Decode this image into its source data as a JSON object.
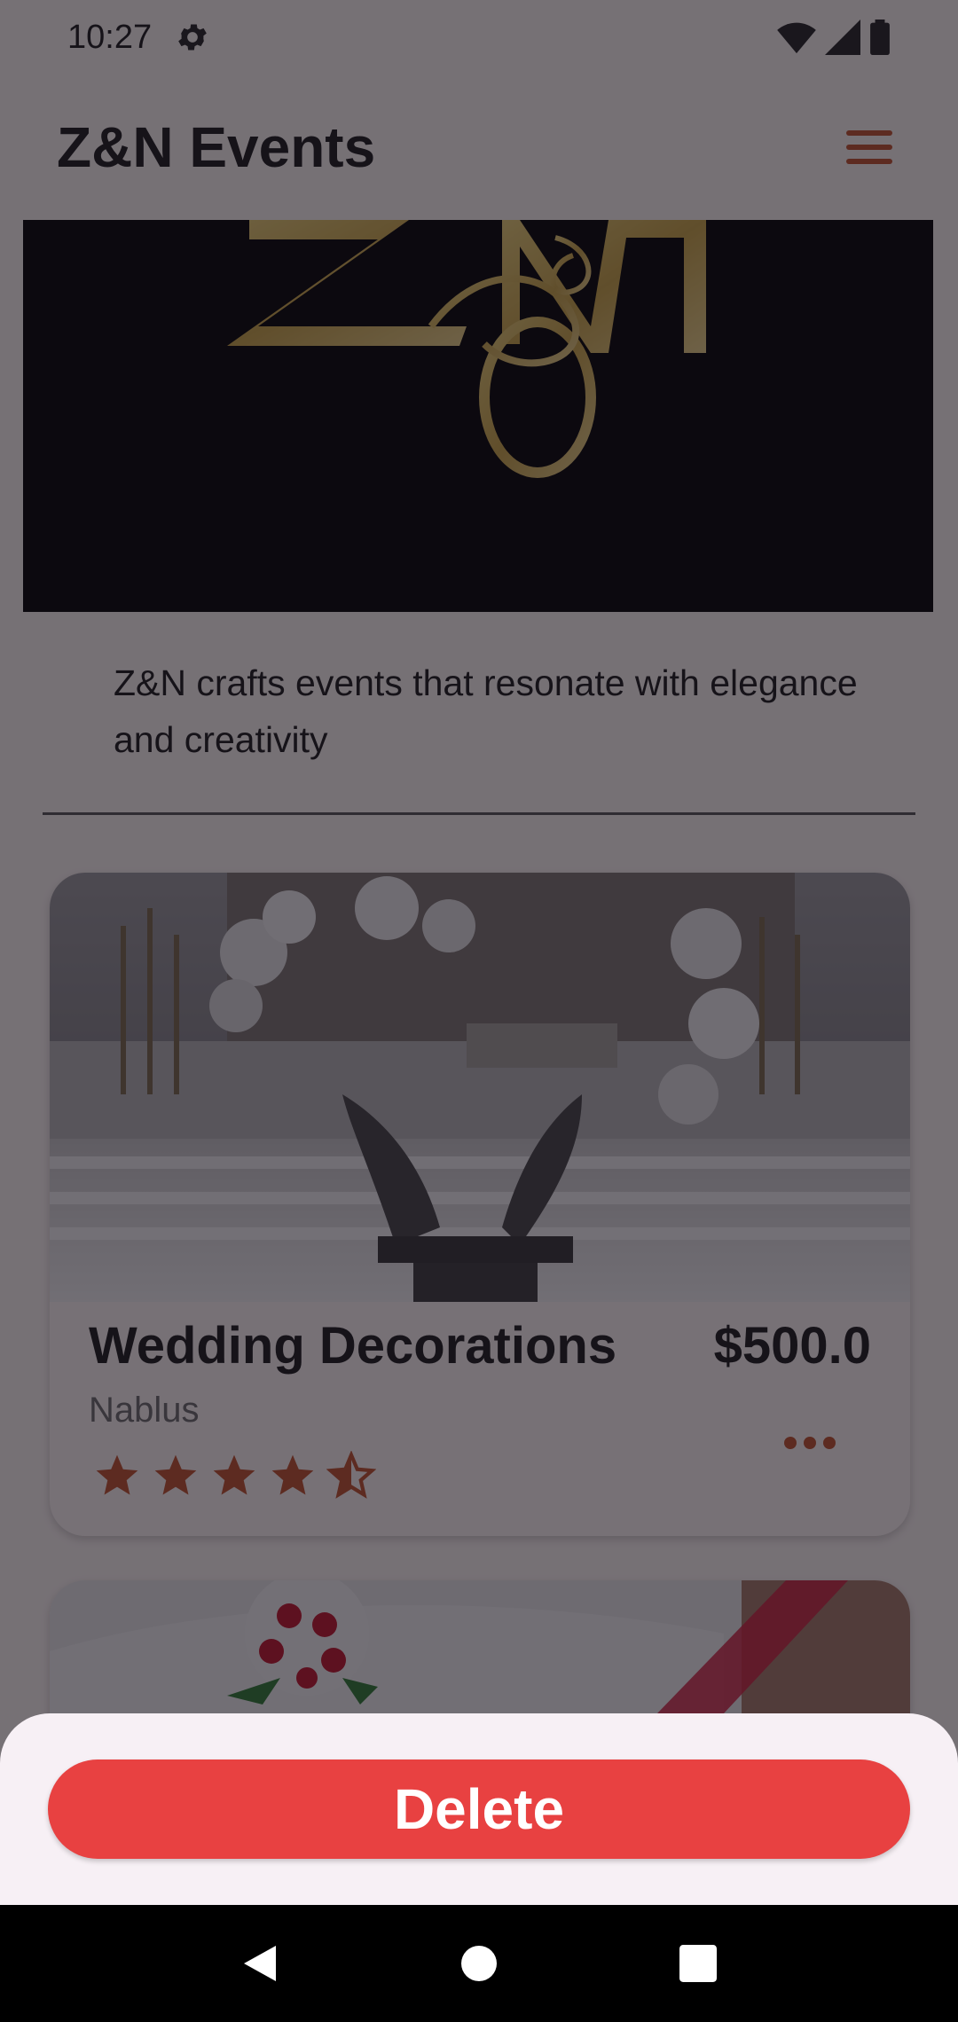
{
  "status_bar": {
    "time": "10:27",
    "icons": [
      "gear-icon",
      "wifi-icon",
      "signal-icon",
      "battery-icon"
    ]
  },
  "app_bar": {
    "title": "Z&N Events",
    "menu_icon": "hamburger-menu-icon"
  },
  "hero": {
    "logo_text": "Z&N",
    "image": "gold Z&N logo on black background"
  },
  "about": {
    "text": "Z&N crafts events that resonate with elegance and creativity"
  },
  "cards": [
    {
      "title": "Wedding Decorations",
      "price": "$500.0",
      "location": "Nablus",
      "rating": 4.5,
      "image": "wedding stage with flowers and dove sculptures"
    },
    {
      "image": "car decorated with red ribbon and roses"
    }
  ],
  "sheet": {
    "delete_label": "Delete"
  },
  "colors": {
    "accent": "#C0522B",
    "delete": "#E84141",
    "background": "#FDF7F4"
  }
}
